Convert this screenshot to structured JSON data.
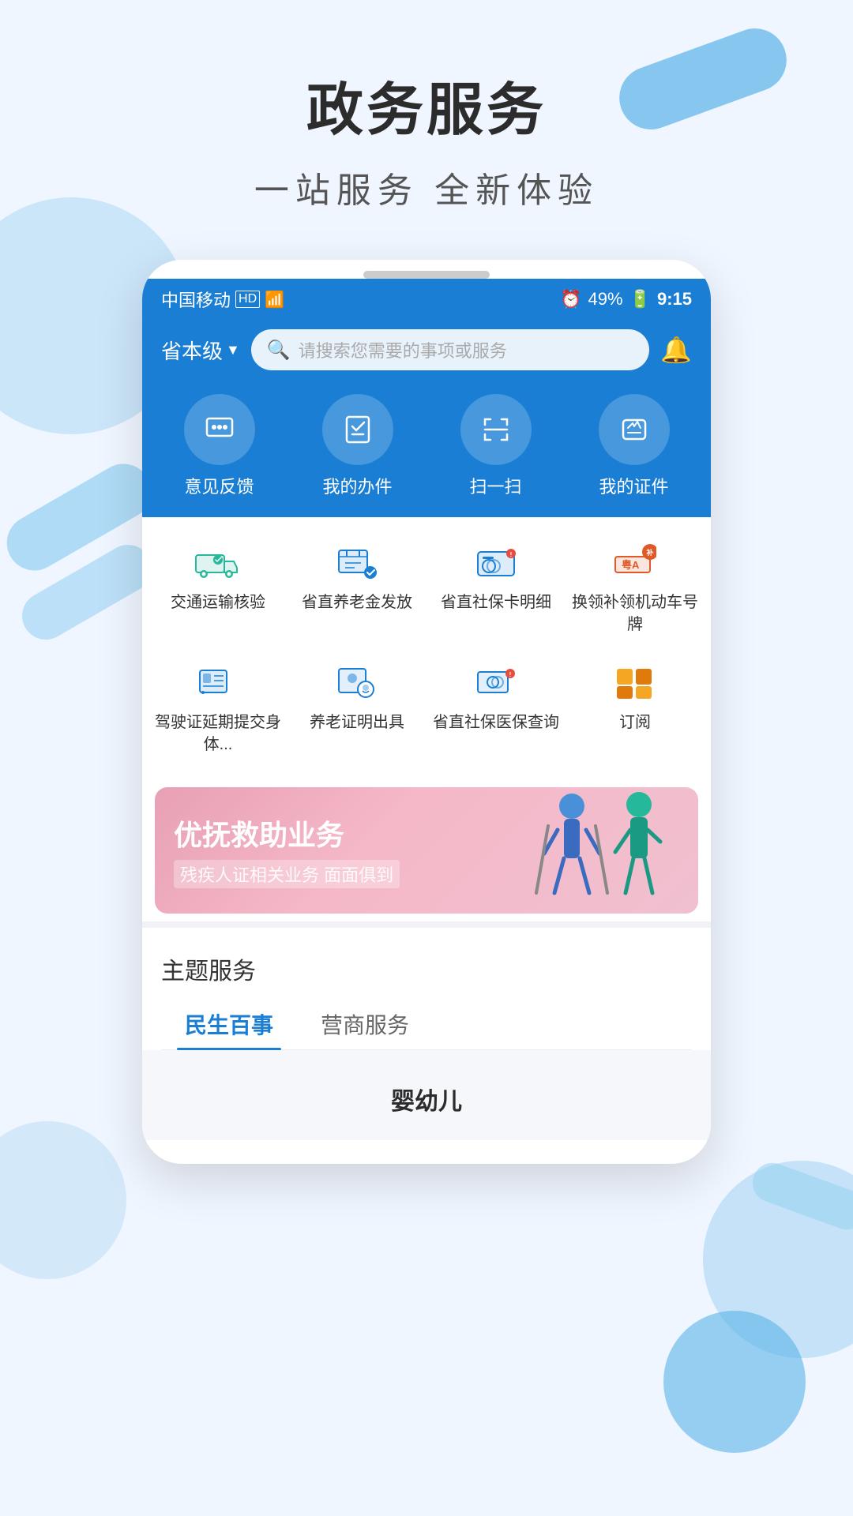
{
  "page": {
    "main_title": "政务服务",
    "sub_title": "一站服务   全新体验"
  },
  "status_bar": {
    "carrier": "中国移动",
    "hd_label": "HD",
    "signal": "4G",
    "alarm": "⏰",
    "battery": "49%",
    "time": "9:15"
  },
  "top_nav": {
    "province": "省本级",
    "dropdown_icon": "▼",
    "search_placeholder": "请搜索您需要的事项或服务",
    "bell_icon": "🔔"
  },
  "quick_actions": [
    {
      "id": "feedback",
      "label": "意见反馈",
      "icon": "🪪"
    },
    {
      "id": "todo",
      "label": "我的办件",
      "icon": "☑️"
    },
    {
      "id": "scan",
      "label": "扫一扫",
      "icon": "⬜"
    },
    {
      "id": "cert",
      "label": "我的证件",
      "icon": "📦"
    }
  ],
  "services": [
    {
      "id": "transport",
      "label": "交通运输核验",
      "color": "#26b89a"
    },
    {
      "id": "pension-release",
      "label": "省直养老金发放",
      "color": "#1a7fd4"
    },
    {
      "id": "social-card",
      "label": "省直社保卡明细",
      "color": "#1a7fd4"
    },
    {
      "id": "plate",
      "label": "换领补领机动车号牌",
      "color": "#e05a28"
    },
    {
      "id": "license-delay",
      "label": "驾驶证延期提交身体...",
      "color": "#1a7fd4"
    },
    {
      "id": "pension-cert",
      "label": "养老证明出具",
      "color": "#1a7fd4"
    },
    {
      "id": "medical-query",
      "label": "省直社保医保查询",
      "color": "#1a7fd4"
    },
    {
      "id": "subscribe",
      "label": "订阅",
      "color": "#f5a623"
    }
  ],
  "banner": {
    "title": "优抚救助业务",
    "subtitle": "残疾人证相关业务  面面俱到"
  },
  "theme_section": {
    "title": "主题服务",
    "tabs": [
      {
        "id": "livelihood",
        "label": "民生百事",
        "active": true
      },
      {
        "id": "business",
        "label": "营商服务",
        "active": false
      }
    ]
  },
  "bottom": {
    "category": "婴幼儿"
  }
}
